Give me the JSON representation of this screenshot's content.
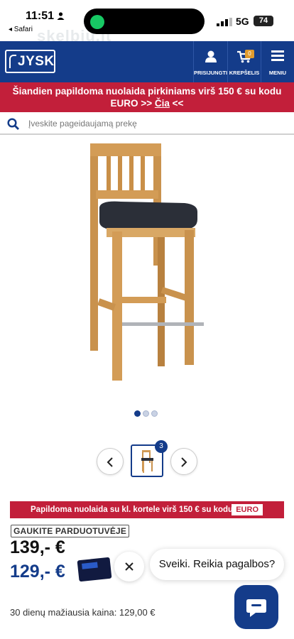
{
  "status_bar": {
    "time": "11:51",
    "back_app": "◂ Safari",
    "network": "5G",
    "battery": "74"
  },
  "watermark": "skelbiu.lt",
  "header": {
    "logo": "JYSK",
    "login_label": "PRISIJUNGTI",
    "cart_label": "KREPŠELIS",
    "cart_count": "0",
    "menu_label": "MENIU"
  },
  "promo": {
    "text": "Šiandien papildoma nuolaida pirkiniams virš 150 € su kodu EURO",
    "arrows_left": ">>",
    "link": "Čia",
    "arrows_right": "<<"
  },
  "search": {
    "placeholder": "Įveskite pageidaujamą prekę"
  },
  "gallery": {
    "count": "3",
    "dots": 3,
    "active_dot": 1
  },
  "banner": {
    "text": "Papildoma nuolaida su kl. kortele virš 150 € su kodu",
    "code": "EURO"
  },
  "product": {
    "store_tag": "GAUKITE PARDUOTUVĖJE",
    "price_old": "139,- €",
    "price_new": "129,- €",
    "lowest_price": "30 dienų mažiausia kaina: 129,00 €"
  },
  "chat": {
    "greeting": "Sveiki. Reikia pagalbos?"
  },
  "colors": {
    "brand_blue": "#143c8a",
    "promo_red": "#c21f3a",
    "cart_badge": "#e09b2d"
  }
}
